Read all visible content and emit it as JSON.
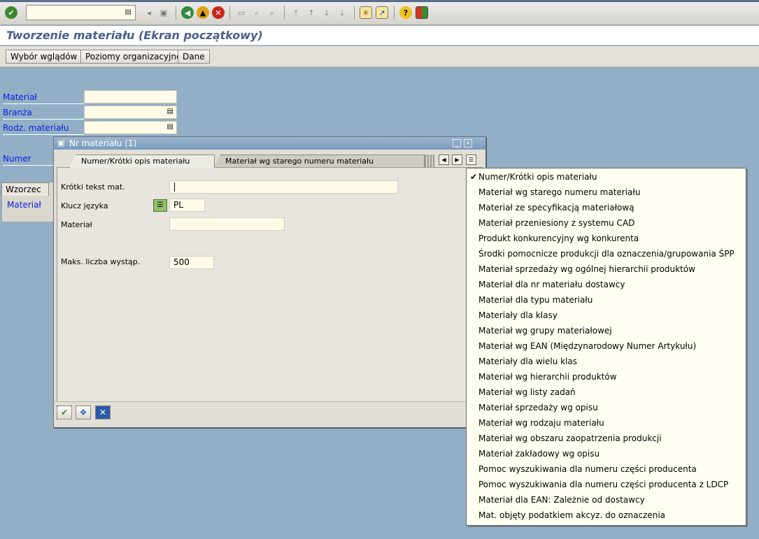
{
  "toolbar": {
    "command_value": "",
    "icons": [
      "enter-icon",
      "back-arrow-icon",
      "save-icon",
      "back-icon",
      "exit-icon",
      "cancel-icon",
      "print-icon",
      "find-icon",
      "find-next-icon",
      "first-page-icon",
      "previous-page-icon",
      "next-page-icon",
      "last-page-icon",
      "new-session-icon",
      "shortcut-icon",
      "help-icon",
      "layout-menu-icon"
    ]
  },
  "title": "Tworzenie materiału (Ekran początkowy)",
  "app_toolbar": {
    "buttons": [
      "Wybór wglądów",
      "Poziomy organizacyjne",
      "Dane"
    ]
  },
  "form": {
    "material_label": "Materiał",
    "industry_label": "Branża",
    "material_type_label": "Rodz. materiału",
    "change_number_label": "Numer zmiany",
    "template_tab": "Wzorzec",
    "template_material_label": "Materiał"
  },
  "dialog": {
    "title": "Nr materiału (1)",
    "tabs": [
      "Numer/Krótki opis materiału",
      "Materiał wg starego numeru materiału"
    ],
    "fields": {
      "short_text_label": "Krótki tekst mat.",
      "short_text_value": "",
      "language_label": "Klucz języka",
      "language_value": "PL",
      "material_label": "Materiał",
      "material_value": "",
      "max_hits_label": "Maks. liczba wystąp.",
      "max_hits_value": "500"
    }
  },
  "dropdown": {
    "selected_index": 0,
    "items": [
      "Numer/Krótki opis materiału",
      "Materiał wg starego numeru materiału",
      "Materiał ze specyfikacją materiałową",
      "Materiał przeniesiony z systemu CAD",
      "Produkt konkurencyjny wg konkurenta",
      "Środki pomocnicze produkcji dla oznaczenia/grupowania ŚPP",
      "Materiał sprzedaży wg ogólnej hierarchii produktów",
      "Materiał dla nr materiału dostawcy",
      "Materiał dla typu materiału",
      "Materiały dla klasy",
      "Materiał wg grupy materiałowej",
      "Materiał wg EAN (Międzynarodowy Numer Artykułu)",
      "Materiały dla wielu klas",
      "Materiał wg hierarchii produktów",
      "Materiał wg listy zadań",
      "Materiał sprzedaży wg opisu",
      "Materiał wg rodzaju materiału",
      "Materiał wg obszaru zaopatrzenia produkcji",
      "Materiał zakładowy wg opisu",
      "Pomoc wyszukiwania dla numeru części producenta",
      "Pomoc wyszukiwania dla numeru części producenta z LDCP",
      "Materiał dla EAN: Zależnie od dostawcy",
      "Mat. objęty podatkiem akcyz. do oznaczenia"
    ]
  },
  "colors": {
    "desktop": "#93afc6",
    "label_blue": "#0b1de0",
    "title_text": "#4a5f8c",
    "input_bg": "#fffbe8"
  }
}
